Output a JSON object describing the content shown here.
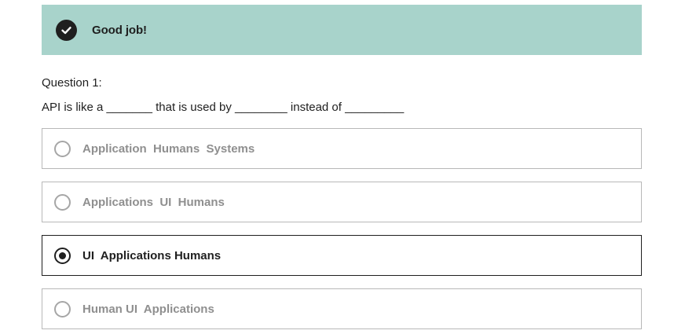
{
  "feedback": {
    "message": "Good job!",
    "icon": "check-circle-icon",
    "background_color": "#a8d3cb"
  },
  "question": {
    "number_label": "Question 1:",
    "text": "API is like a _______ that is used by ________ instead of _________"
  },
  "options": [
    {
      "label": "Application  Humans  Systems",
      "selected": false
    },
    {
      "label": "Applications  UI  Humans",
      "selected": false
    },
    {
      "label": "UI  Applications Humans",
      "selected": true
    },
    {
      "label": "Human UI  Applications",
      "selected": false
    }
  ]
}
